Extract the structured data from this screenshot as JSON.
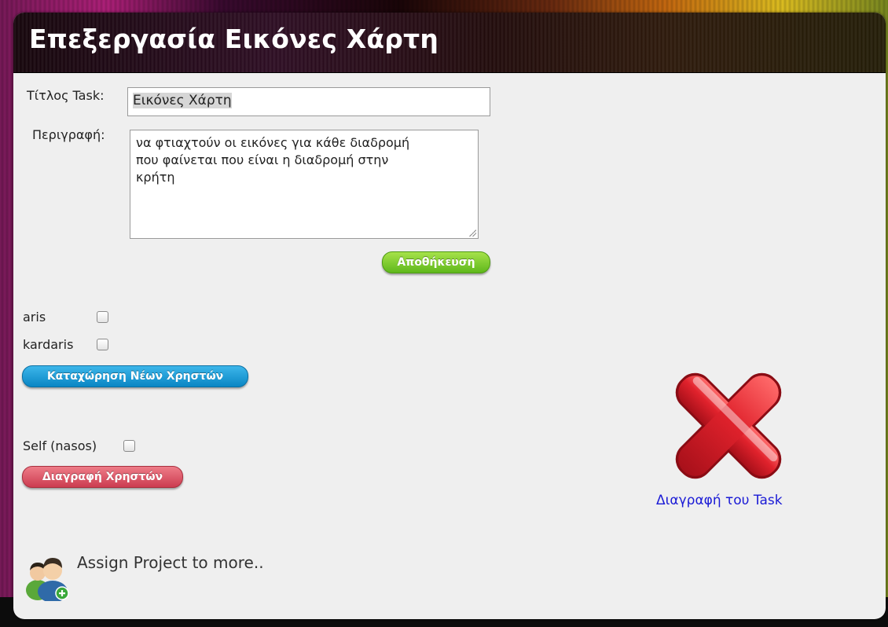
{
  "dialog": {
    "title": "Επεξεργασία Εικόνες Χάρτη"
  },
  "form": {
    "title_label": "Τίτλος Task:",
    "title_value": "Εικόνες Χάρτη",
    "description_label": "Περιγραφή:",
    "description_value": "να φτιαχτούν οι εικόνες για κάθε διαδρομή\nπου φαίνεται που είναι η διαδρομή στην\nκρήτη",
    "save_label": "Αποθήκευση"
  },
  "add_users": {
    "users": [
      {
        "name": "aris",
        "checked": false
      },
      {
        "name": "kardaris",
        "checked": false
      }
    ],
    "submit_label": "Καταχώρηση Νέων Χρηστών"
  },
  "remove_users": {
    "users": [
      {
        "name": "Self (nasos)",
        "checked": false
      }
    ],
    "submit_label": "Διαγραφή Χρηστών"
  },
  "delete_task": {
    "icon": "red-x-icon",
    "label": "Διαγραφή του Task"
  },
  "assign": {
    "icon": "users-add-icon",
    "label": "Assign Project to more.."
  },
  "colors": {
    "save_button": "#6cc424",
    "add_button": "#1a97d4",
    "remove_button": "#dd5564",
    "link": "#1a1ad6",
    "delete_icon": "#e0222c"
  }
}
